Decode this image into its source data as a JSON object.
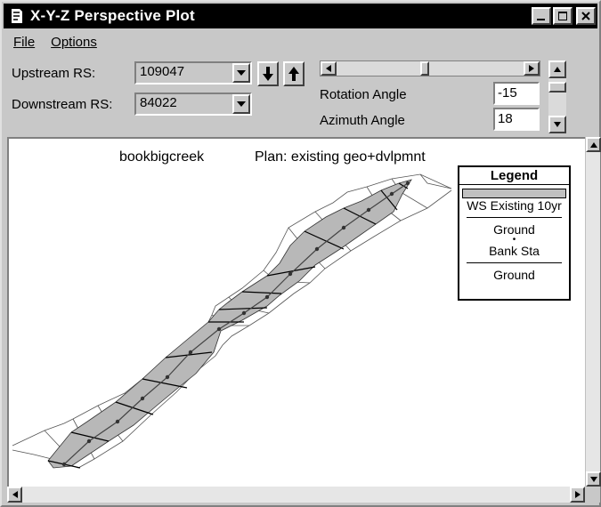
{
  "window": {
    "title": "X-Y-Z Perspective Plot"
  },
  "menu": {
    "file": "File",
    "options": "Options"
  },
  "controls": {
    "upstream_label": "Upstream RS:",
    "upstream_value": "109047",
    "downstream_label": "Downstream RS:",
    "downstream_value": "84022",
    "rotation_label": "Rotation Angle",
    "rotation_value": "-15",
    "azimuth_label": "Azimuth Angle",
    "azimuth_value": "18",
    "rotation_slider_fraction": 0.47
  },
  "plot": {
    "project": "bookbigcreek",
    "plan": "Plan: existing geo+dvlpmnt",
    "legend": {
      "title": "Legend",
      "ws": "WS Existing 10yr",
      "ground": "Ground",
      "bank": "Bank Sta",
      "ground2": "Ground"
    }
  },
  "colors": {
    "water_fill": "#b8b8b8",
    "titlebar": "#000000",
    "face": "#c8c8c8"
  },
  "icons": [
    "app-icon",
    "minimize-icon",
    "maximize-icon",
    "close-icon",
    "chevron-down-icon",
    "arrow-down-icon",
    "arrow-up-icon",
    "arrow-left-icon",
    "arrow-right-icon"
  ]
}
